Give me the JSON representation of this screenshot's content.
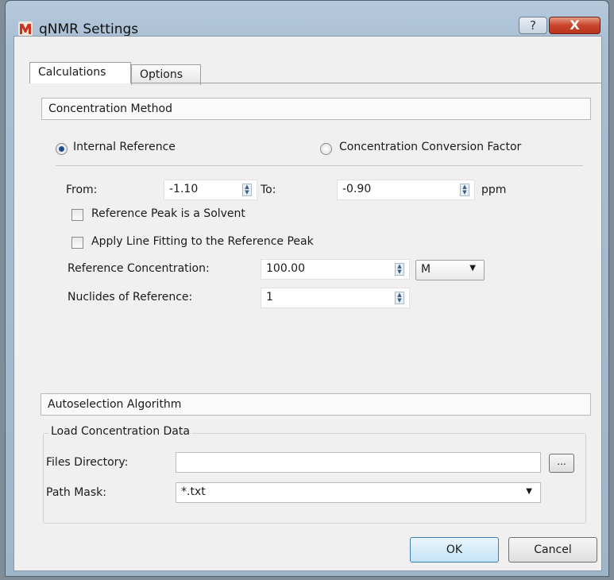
{
  "window": {
    "title": "qNMR Settings",
    "help_label": "?",
    "close_label": "X"
  },
  "tabs": [
    {
      "label": "Calculations",
      "active": true
    },
    {
      "label": "Options",
      "active": false
    }
  ],
  "concentration_method": {
    "header": "Concentration Method",
    "options": [
      {
        "label": "Internal Reference",
        "selected": true
      },
      {
        "label": "Concentration Conversion Factor",
        "selected": false
      }
    ],
    "from_label": "From:",
    "from_value": "-1.10",
    "to_label": "To:",
    "to_value": "-0.90",
    "unit": "ppm",
    "checkboxes": [
      {
        "label": "Reference Peak is a Solvent",
        "checked": false
      },
      {
        "label": "Apply Line Fitting to the Reference Peak",
        "checked": false
      }
    ],
    "ref_conc_label": "Reference Concentration:",
    "ref_conc_value": "100.00",
    "ref_conc_unit": "M",
    "nuclides_label": "Nuclides of Reference:",
    "nuclides_value": "1"
  },
  "autoselection": {
    "header": "Autoselection Algorithm",
    "group_title": "Load Concentration Data",
    "files_dir_label": "Files Directory:",
    "files_dir_value": "",
    "browse_label": "...",
    "path_mask_label": "Path Mask:",
    "path_mask_value": "*.txt"
  },
  "buttons": {
    "ok": "OK",
    "cancel": "Cancel"
  },
  "colors": {
    "titlebar": "#a8bed3",
    "close": "#c9452c",
    "selection": "#1f4d8f"
  }
}
